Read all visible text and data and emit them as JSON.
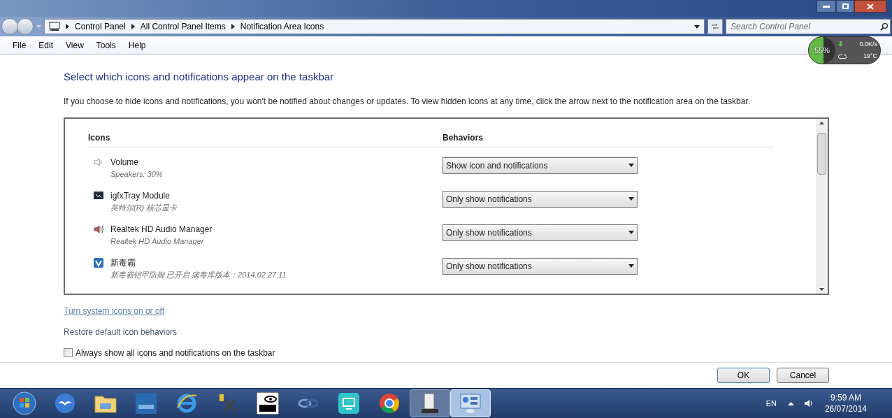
{
  "address_bar": {
    "breadcrumbs": [
      "Control Panel",
      "All Control Panel Items",
      "Notification Area Icons"
    ],
    "search_placeholder": "Search Control Panel"
  },
  "menu": [
    "File",
    "Edit",
    "View",
    "Tools",
    "Help"
  ],
  "gadget": {
    "cpu": "55%",
    "level": 0.55,
    "network": "0.0K/s",
    "temperature": "19°C"
  },
  "heading": "Select which icons and notifications appear on the taskbar",
  "description": "If you choose to hide icons and notifications, you won't be notified about changes or updates. To view hidden icons at any time, click the arrow next to the notification area on the taskbar.",
  "table": {
    "columns": [
      "Icons",
      "Behaviors"
    ],
    "rows": [
      {
        "kind": "volume",
        "name": "Volume",
        "detail": "Speakers: 30%",
        "behavior": "Show icon and notifications"
      },
      {
        "kind": "graphics",
        "name": "igfxTray Module",
        "detail": "英特尔(R) 核芯显卡",
        "behavior": "Only show notifications"
      },
      {
        "kind": "audio",
        "name": "Realtek HD Audio Manager",
        "detail": "Realtek HD Audio Manager",
        "behavior": "Only show notifications"
      },
      {
        "kind": "antivirus",
        "name": "新毒霸",
        "detail": "新毒霸铠甲防御 已开启 病毒库版本：2014.02.27.11",
        "behavior": "Only show notifications"
      }
    ]
  },
  "links": [
    "Turn system icons on or off",
    "Restore default icon behaviors"
  ],
  "always_show": {
    "label": "Always show all icons and notifications on the taskbar",
    "checked": false
  },
  "buttons": [
    "OK",
    "Cancel"
  ],
  "taskbar": {
    "apps": [
      {
        "kind": "start"
      },
      {
        "kind": "bird"
      },
      {
        "kind": "folder"
      },
      {
        "kind": "tile"
      },
      {
        "kind": "ie"
      },
      {
        "kind": "tools"
      },
      {
        "kind": "vnc"
      },
      {
        "kind": "link"
      },
      {
        "kind": "screen"
      },
      {
        "kind": "chrome"
      },
      {
        "kind": "server",
        "selected": false
      },
      {
        "kind": "panel",
        "selected": true
      }
    ],
    "language": "EN",
    "time": "9:59 AM",
    "date": "26/07/2014"
  }
}
